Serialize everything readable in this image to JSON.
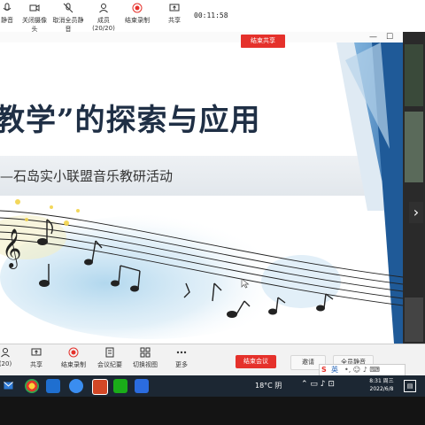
{
  "meeting": {
    "toolbar": [
      {
        "name": "mute-button",
        "label": "静音",
        "icon": "mic-icon"
      },
      {
        "name": "camera-button",
        "label": "关闭摄像头",
        "icon": "camera-icon"
      },
      {
        "name": "unmute-all-button",
        "label": "取消全员静音",
        "icon": "mic-off-icon"
      },
      {
        "name": "members-button",
        "label": "成员(20/20)",
        "icon": "people-icon"
      },
      {
        "name": "stop-recording-button",
        "label": "结束录制",
        "icon": "record-icon"
      },
      {
        "name": "share-button",
        "label": "共享",
        "icon": "share-icon"
      }
    ],
    "timer": "00:11:58",
    "stop_share_label": "结束共享",
    "accent": "#e5312b"
  },
  "window": {
    "minimize": "—",
    "maximize": "☐",
    "close": "✕"
  },
  "slide": {
    "title": "教学”的探索与应用",
    "subtitle": "—石岛实小联盟音乐教研活动"
  },
  "bottom_toolbar": {
    "items": [
      {
        "name": "members-count",
        "label": "(20)",
        "icon": "people-icon"
      },
      {
        "name": "share-button",
        "label": "共享",
        "icon": "share-icon"
      },
      {
        "name": "stop-recording-button",
        "label": "结束录制",
        "icon": "record-icon"
      },
      {
        "name": "meeting-minutes-button",
        "label": "会议纪要",
        "icon": "doc-icon"
      },
      {
        "name": "switch-view-button",
        "label": "切换视图",
        "icon": "grid-icon"
      },
      {
        "name": "more-button",
        "label": "更多",
        "icon": "more-icon"
      }
    ],
    "end_meeting_label": "结束会议",
    "reverse_label": "邀请",
    "mute_all_label": "全员静音"
  },
  "taskbar": {
    "weather": "18°C 阴",
    "ime": "英",
    "time": "8:31 周三",
    "date": "2022/6/8"
  }
}
